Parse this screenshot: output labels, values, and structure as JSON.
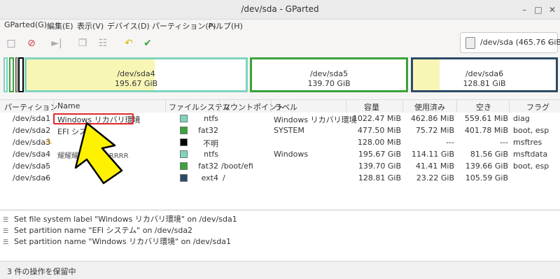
{
  "window": {
    "title": "/dev/sda - GParted"
  },
  "menu": [
    "GParted(G)",
    "編集(E)",
    "表示(V)",
    "デバイス(D)",
    "パーティション(P)",
    "ヘルプ(H)"
  ],
  "device": {
    "label": "/dev/sda  (465.76 GiB)"
  },
  "map": {
    "sda4": {
      "name": "/dev/sda4",
      "size": "195.67 GiB"
    },
    "sda5": {
      "name": "/dev/sda5",
      "size": "139.70 GiB"
    },
    "sda6": {
      "name": "/dev/sda6",
      "size": "128.81 GiB"
    }
  },
  "columns": [
    "パーティション",
    "Name",
    "ファイルシステム",
    "マウントポイント",
    "ラベル",
    "容量",
    "使用済み",
    "空き",
    "フラグ"
  ],
  "rows": [
    {
      "partition": "/dev/sda1",
      "name": "Windows リカバリ環境",
      "fs": "ntfs",
      "color": "#7fd4be",
      "mount": "",
      "label": "Windows リカバリ環境",
      "size": "1022.47 MiB",
      "used": "462.86 MiB",
      "free": "559.61 MiB",
      "flags": "diag"
    },
    {
      "partition": "/dev/sda2",
      "name": "EFI シス",
      "fs": "fat32",
      "color": "#3aa33a",
      "mount": "",
      "label": "SYSTEM",
      "size": "477.50 MiB",
      "used": "75.72 MiB",
      "free": "401.78 MiB",
      "flags": "boot, esp"
    },
    {
      "partition": "/dev/sda3",
      "name": "",
      "fs": "不明",
      "color": "#000000",
      "mount": "",
      "label": "",
      "size": "128.00 MiB",
      "used": "---",
      "free": "---",
      "flags": "msftres"
    },
    {
      "partition": "/dev/sda4",
      "name": "",
      "fs": "ntfs",
      "color": "#7fd4be",
      "mount": "",
      "label": "Windows",
      "size": "195.67 GiB",
      "used": "114.11 GiB",
      "free": "81.56 GiB",
      "flags": "msftdata"
    },
    {
      "partition": "/dev/sda5",
      "name": "",
      "fs": "fat32",
      "color": "#3aa33a",
      "mount": "/boot/efi",
      "label": "",
      "size": "139.70 GiB",
      "used": "41.41 MiB",
      "free": "139.66 GiB",
      "flags": "boot, esp"
    },
    {
      "partition": "/dev/sda6",
      "name": "",
      "fs": "ext4",
      "color": "#2b4a66",
      "mount": "/",
      "label": "",
      "size": "128.81 GiB",
      "used": "23.22 GiB",
      "free": "105.59 GiB",
      "flags": ""
    }
  ],
  "garbled_text": "耀耀耀耀耀耀ARRRRR",
  "operations": [
    "Set file system label \"Windows リカバリ環境\" on /dev/sda1",
    "Set partition name \"EFI システム\" on /dev/sda2",
    "Set partition name \"Windows リカバリ環境\" on /dev/sda1"
  ],
  "status": "3 件の操作を保留中",
  "colors": {
    "highlight": "#e3262a",
    "arrow": "#fff200"
  }
}
